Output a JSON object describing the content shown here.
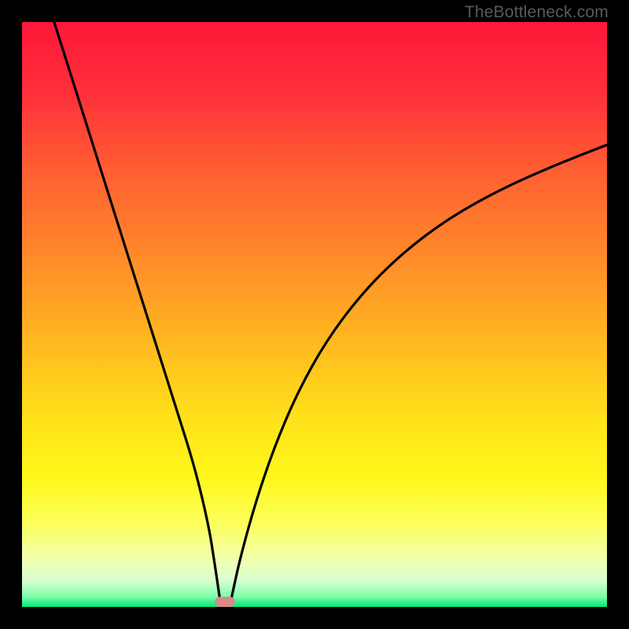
{
  "watermark": "TheBottleneck.com",
  "chart_data": {
    "type": "line",
    "title": "",
    "xlabel": "",
    "ylabel": "",
    "xlim": [
      0,
      1
    ],
    "ylim": [
      0,
      1
    ],
    "gradient_stops": [
      {
        "pos": 0.0,
        "color": "#ff173a"
      },
      {
        "pos": 0.12,
        "color": "#ff2f3a"
      },
      {
        "pos": 0.25,
        "color": "#ff5d32"
      },
      {
        "pos": 0.4,
        "color": "#ff8a2a"
      },
      {
        "pos": 0.55,
        "color": "#ffb91f"
      },
      {
        "pos": 0.68,
        "color": "#ffe21a"
      },
      {
        "pos": 0.78,
        "color": "#fff71a"
      },
      {
        "pos": 0.86,
        "color": "#fcff60"
      },
      {
        "pos": 0.92,
        "color": "#f1ffb0"
      },
      {
        "pos": 0.955,
        "color": "#d7ffd2"
      },
      {
        "pos": 0.982,
        "color": "#7effa9"
      },
      {
        "pos": 1.0,
        "color": "#00e676"
      }
    ],
    "series": [
      {
        "name": "left-branch",
        "x": [
          0.055,
          0.085,
          0.115,
          0.145,
          0.175,
          0.205,
          0.235,
          0.265,
          0.295,
          0.319,
          0.33,
          0.338
        ],
        "y": [
          1.0,
          0.905,
          0.81,
          0.715,
          0.62,
          0.525,
          0.43,
          0.335,
          0.24,
          0.14,
          0.07,
          0.015
        ]
      },
      {
        "name": "right-branch",
        "x": [
          0.358,
          0.372,
          0.398,
          0.43,
          0.47,
          0.52,
          0.58,
          0.65,
          0.73,
          0.82,
          0.91,
          1.0
        ],
        "y": [
          0.015,
          0.08,
          0.175,
          0.27,
          0.365,
          0.455,
          0.535,
          0.605,
          0.665,
          0.715,
          0.755,
          0.79
        ]
      }
    ],
    "min_marker": {
      "x": 0.347,
      "y": 0.009
    }
  }
}
